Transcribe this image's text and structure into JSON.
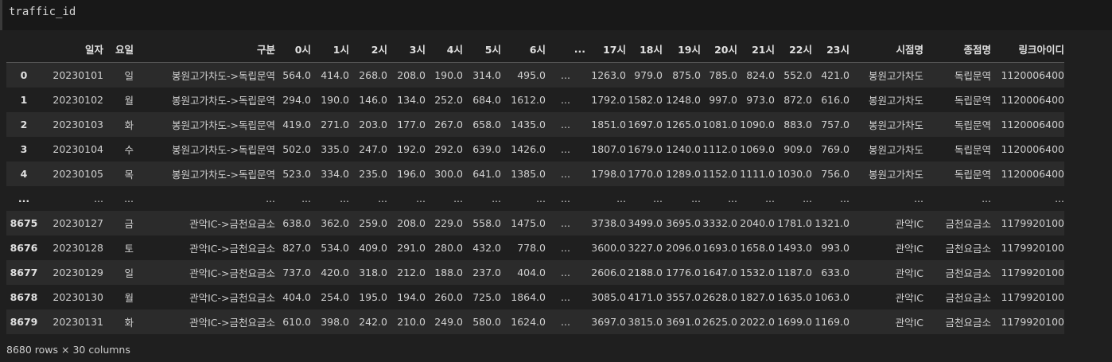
{
  "input": {
    "code": "traffic_id"
  },
  "table": {
    "columns": [
      "",
      "일자",
      "요일",
      "구분",
      "0시",
      "1시",
      "2시",
      "3시",
      "4시",
      "5시",
      "6시",
      "...",
      "17시",
      "18시",
      "19시",
      "20시",
      "21시",
      "22시",
      "23시",
      "시점명",
      "종점명",
      "링크아이디"
    ],
    "rows": [
      [
        "0",
        "20230101",
        "일",
        "봉원고가차도->독립문역",
        "564.0",
        "414.0",
        "268.0",
        "208.0",
        "190.0",
        "314.0",
        "495.0",
        "...",
        "1263.0",
        "979.0",
        "875.0",
        "785.0",
        "824.0",
        "552.0",
        "421.0",
        "봉원고가차도",
        "독립문역",
        "1120006400"
      ],
      [
        "1",
        "20230102",
        "월",
        "봉원고가차도->독립문역",
        "294.0",
        "190.0",
        "146.0",
        "134.0",
        "252.0",
        "684.0",
        "1612.0",
        "...",
        "1792.0",
        "1582.0",
        "1248.0",
        "997.0",
        "973.0",
        "872.0",
        "616.0",
        "봉원고가차도",
        "독립문역",
        "1120006400"
      ],
      [
        "2",
        "20230103",
        "화",
        "봉원고가차도->독립문역",
        "419.0",
        "271.0",
        "203.0",
        "177.0",
        "267.0",
        "658.0",
        "1435.0",
        "...",
        "1851.0",
        "1697.0",
        "1265.0",
        "1081.0",
        "1090.0",
        "883.0",
        "757.0",
        "봉원고가차도",
        "독립문역",
        "1120006400"
      ],
      [
        "3",
        "20230104",
        "수",
        "봉원고가차도->독립문역",
        "502.0",
        "335.0",
        "247.0",
        "192.0",
        "292.0",
        "639.0",
        "1426.0",
        "...",
        "1807.0",
        "1679.0",
        "1240.0",
        "1112.0",
        "1069.0",
        "909.0",
        "769.0",
        "봉원고가차도",
        "독립문역",
        "1120006400"
      ],
      [
        "4",
        "20230105",
        "목",
        "봉원고가차도->독립문역",
        "523.0",
        "334.0",
        "235.0",
        "196.0",
        "300.0",
        "641.0",
        "1385.0",
        "...",
        "1798.0",
        "1770.0",
        "1289.0",
        "1152.0",
        "1111.0",
        "1030.0",
        "756.0",
        "봉원고가차도",
        "독립문역",
        "1120006400"
      ],
      [
        "...",
        "...",
        "...",
        "...",
        "...",
        "...",
        "...",
        "...",
        "...",
        "...",
        "...",
        "...",
        "...",
        "...",
        "...",
        "...",
        "...",
        "...",
        "...",
        "...",
        "...",
        "..."
      ],
      [
        "8675",
        "20230127",
        "금",
        "관악IC->금천요금소",
        "638.0",
        "362.0",
        "259.0",
        "208.0",
        "229.0",
        "558.0",
        "1475.0",
        "...",
        "3738.0",
        "3499.0",
        "3695.0",
        "3332.0",
        "2040.0",
        "1781.0",
        "1321.0",
        "관악IC",
        "금천요금소",
        "1179920100"
      ],
      [
        "8676",
        "20230128",
        "토",
        "관악IC->금천요금소",
        "827.0",
        "534.0",
        "409.0",
        "291.0",
        "280.0",
        "432.0",
        "778.0",
        "...",
        "3600.0",
        "3227.0",
        "2096.0",
        "1693.0",
        "1658.0",
        "1493.0",
        "993.0",
        "관악IC",
        "금천요금소",
        "1179920100"
      ],
      [
        "8677",
        "20230129",
        "일",
        "관악IC->금천요금소",
        "737.0",
        "420.0",
        "318.0",
        "212.0",
        "188.0",
        "237.0",
        "404.0",
        "...",
        "2606.0",
        "2188.0",
        "1776.0",
        "1647.0",
        "1532.0",
        "1187.0",
        "633.0",
        "관악IC",
        "금천요금소",
        "1179920100"
      ],
      [
        "8678",
        "20230130",
        "월",
        "관악IC->금천요금소",
        "404.0",
        "254.0",
        "195.0",
        "194.0",
        "260.0",
        "725.0",
        "1864.0",
        "...",
        "3085.0",
        "4171.0",
        "3557.0",
        "2628.0",
        "1827.0",
        "1635.0",
        "1063.0",
        "관악IC",
        "금천요금소",
        "1179920100"
      ],
      [
        "8679",
        "20230131",
        "화",
        "관악IC->금천요금소",
        "610.0",
        "398.0",
        "242.0",
        "210.0",
        "249.0",
        "580.0",
        "1624.0",
        "...",
        "3697.0",
        "3815.0",
        "3691.0",
        "2625.0",
        "2022.0",
        "1699.0",
        "1169.0",
        "관악IC",
        "금천요금소",
        "1179920100"
      ]
    ]
  },
  "footer": {
    "shape": "8680 rows × 30 columns"
  }
}
